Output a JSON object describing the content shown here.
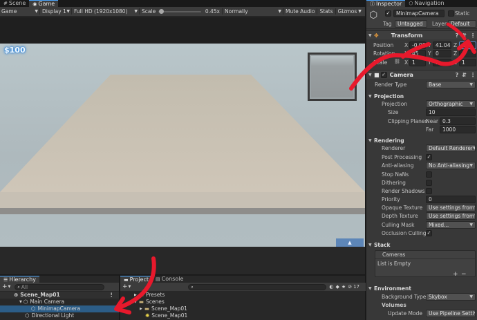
{
  "tabs": {
    "scene": "Scene",
    "game": "Game",
    "inspector": "Inspector",
    "navigation": "Navigation"
  },
  "game_toolbar": {
    "display_mode": "Game",
    "display": "Display 1",
    "resolution": "Full HD (1920x1080)",
    "scale_label": "Scale",
    "scale_value": "0.45x",
    "scale_fraction": 0.45,
    "aspect": "Normally",
    "mute_audio": "Mute Audio",
    "stats": "Stats",
    "gizmos": "Gizmos"
  },
  "game_view": {
    "money": "$100"
  },
  "inspector": {
    "object_name": "MinimapCamera",
    "static_label": "Static",
    "tag_label": "Tag",
    "tag_value": "Untagged",
    "layer_label": "Layer",
    "layer_value": "Default",
    "transform": {
      "title": "Transform",
      "position_label": "Position",
      "rotation_label": "Rotation",
      "scale_label": "Scale",
      "position": {
        "x": "-0.03",
        "y": "41.04",
        "z": "-25"
      },
      "rotation": {
        "x": "45",
        "y": "0",
        "z": "0"
      },
      "scale": {
        "x": "1",
        "y": "1",
        "z": "1"
      }
    },
    "camera": {
      "title": "Camera",
      "render_type_label": "Render Type",
      "render_type_value": "Base",
      "projection_head": "Projection",
      "projection_label": "Projection",
      "projection_value": "Orthographic",
      "size_label": "Size",
      "size_value": "10",
      "clipping_label": "Clipping Planes",
      "near_label": "Near",
      "near_value": "0.3",
      "far_label": "Far",
      "far_value": "1000",
      "rendering_head": "Rendering",
      "renderer_label": "Renderer",
      "renderer_value": "Default Renderer",
      "post_processing_label": "Post Processing",
      "anti_aliasing_label": "Anti-aliasing",
      "anti_aliasing_value": "No Anti-aliasing",
      "stop_nans_label": "Stop NaNs",
      "dithering_label": "Dithering",
      "render_shadows_label": "Render Shadows",
      "priority_label": "Priority",
      "priority_value": "0",
      "opaque_texture_label": "Opaque Texture",
      "opaque_texture_value": "Use settings from",
      "depth_texture_label": "Depth Texture",
      "depth_texture_value": "Use settings from",
      "culling_mask_label": "Culling Mask",
      "culling_mask_value": "Mixed...",
      "occlusion_culling_label": "Occlusion Culling"
    },
    "stack": {
      "head": "Stack",
      "cameras_label": "Cameras",
      "empty_text": "List is Empty"
    },
    "environment": {
      "head": "Environment",
      "background_type_label": "Background Type",
      "background_type_value": "Skybox",
      "volumes_label": "Volumes",
      "update_mode_label": "Update Mode",
      "update_mode_value": "Use Pipeline Setti"
    }
  },
  "hierarchy": {
    "title": "Hierarchy",
    "search_placeholder": "All",
    "items": [
      "Scene_Map01",
      "Main Camera",
      "MinimapCamera",
      "Directional Light"
    ]
  },
  "project": {
    "tab_project": "Project",
    "tab_console": "Console",
    "badge_count": "17",
    "items": [
      "Presets",
      "Scenes",
      "Scene_Map01",
      "Scene_Map01"
    ]
  },
  "colors": {
    "accent": "#4aa6ff",
    "annotation": "#e8192c",
    "selection": "#2c5d87"
  }
}
